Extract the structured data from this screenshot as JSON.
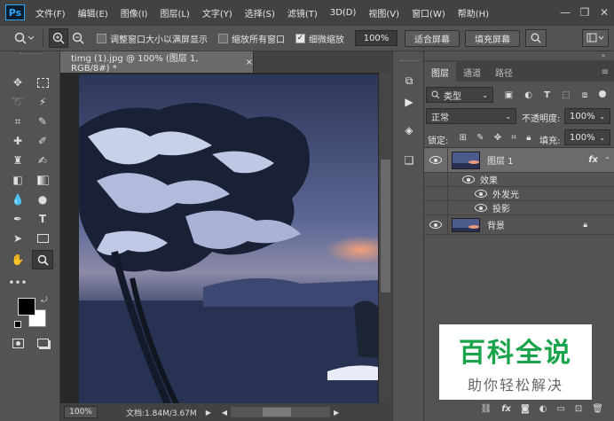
{
  "app": {
    "logo": "Ps"
  },
  "menu": [
    "文件(F)",
    "编辑(E)",
    "图像(I)",
    "图层(L)",
    "文字(Y)",
    "选择(S)",
    "滤镜(T)",
    "3D(D)",
    "视图(V)",
    "窗口(W)",
    "帮助(H)"
  ],
  "window_controls": {
    "minimize": "—",
    "restore": "❐",
    "close": "✕"
  },
  "options": {
    "resize_windows_label": "调整窗口大小以满屏显示",
    "zoom_all_label": "缩放所有窗口",
    "scrubby_label": "细微缩放",
    "scrubby_checked": true,
    "zoom_value": "100%",
    "fit_screen": "适合屏幕",
    "fill_screen": "填充屏幕"
  },
  "document": {
    "tab_title": "timg (1).jpg @ 100% (图层 1, RGB/8#) *",
    "close": "×",
    "zoom": "100%",
    "doc_info": "文档:1.84M/3.67M"
  },
  "colors": {
    "foreground": "#000000",
    "background": "#ffffff",
    "accent": "#31a8ff"
  },
  "layers_panel": {
    "tabs": [
      "图层",
      "通道",
      "路径"
    ],
    "active_tab": "图层",
    "filter_kind": "类型",
    "blend_mode": "正常",
    "opacity_label": "不透明度:",
    "opacity_value": "100%",
    "lock_label": "锁定:",
    "fill_label": "填充:",
    "fill_value": "100%",
    "layers": [
      {
        "name": "图层 1",
        "fx": "fx",
        "selected": true
      },
      {
        "name": "背景",
        "locked": true
      }
    ],
    "effects_label": "效果",
    "effects": [
      "外发光",
      "投影"
    ],
    "bottom_icons": [
      "link-icon",
      "fx-icon",
      "mask-icon",
      "adjustment-icon",
      "group-icon",
      "new-layer-icon",
      "trash-icon"
    ]
  },
  "watermark": {
    "title": "百科全说",
    "subtitle": "助你轻松解决"
  }
}
